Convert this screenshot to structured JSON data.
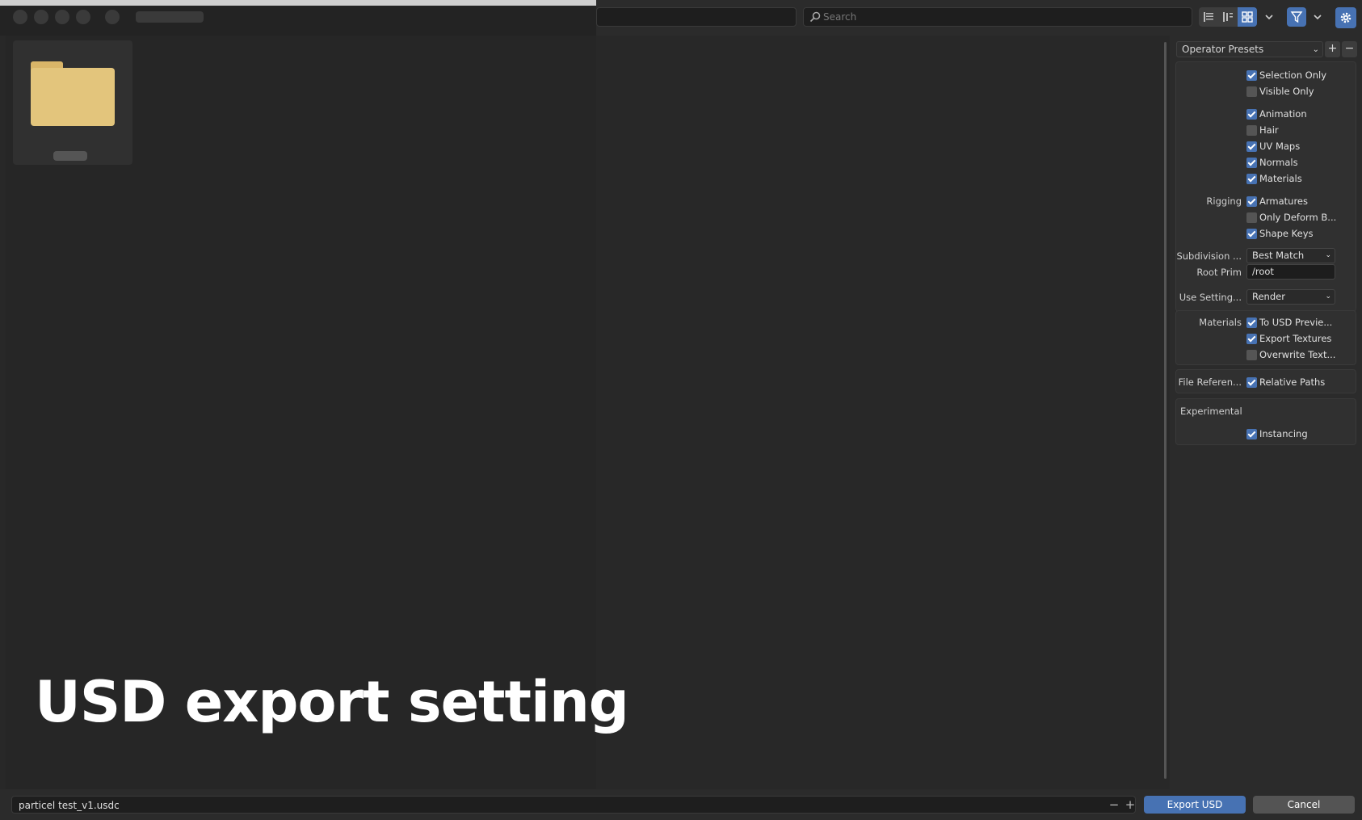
{
  "header": {
    "search_placeholder": "Search",
    "icons": [
      "list-vertical-icon",
      "list-horizontal-icon",
      "thumbnails-icon",
      "filter-icon",
      "gear-icon"
    ]
  },
  "overlay_title": "USD export setting",
  "sidebar": {
    "presets_label": "Operator Presets",
    "add_label": "+",
    "remove_label": "−",
    "general": {
      "selection_only": {
        "label": "Selection Only",
        "checked": true
      },
      "visible_only": {
        "label": "Visible Only",
        "checked": false
      },
      "animation": {
        "label": "Animation",
        "checked": true
      },
      "hair": {
        "label": "Hair",
        "checked": false
      },
      "uv_maps": {
        "label": "UV Maps",
        "checked": true
      },
      "normals": {
        "label": "Normals",
        "checked": true
      },
      "materials": {
        "label": "Materials",
        "checked": true
      },
      "rigging_label": "Rigging",
      "armatures": {
        "label": "Armatures",
        "checked": true
      },
      "only_deform": {
        "label": "Only Deform B...",
        "checked": false
      },
      "shape_keys": {
        "label": "Shape Keys",
        "checked": true
      },
      "subdivision_label": "Subdivision ...",
      "subdivision_value": "Best Match",
      "root_prim_label": "Root Prim",
      "root_prim_value": "/root",
      "use_settings_label": "Use Setting...",
      "use_settings_value": "Render"
    },
    "materials_panel": {
      "label": "Materials",
      "to_usd_preview": {
        "label": "To USD Previe...",
        "checked": true
      },
      "export_textures": {
        "label": "Export Textures",
        "checked": true
      },
      "overwrite_textures": {
        "label": "Overwrite Text...",
        "checked": false
      }
    },
    "file_refs": {
      "label": "File Referen...",
      "relative_paths": {
        "label": "Relative Paths",
        "checked": true
      }
    },
    "experimental": {
      "label": "Experimental",
      "instancing": {
        "label": "Instancing",
        "checked": true
      }
    }
  },
  "footer": {
    "filename": "particel test_v1.usdc",
    "minus_label": "−",
    "plus_label": "+",
    "export_label": "Export USD",
    "cancel_label": "Cancel"
  },
  "colors": {
    "accent": "#4772b3",
    "folder": "#e3c57c",
    "background": "#282828"
  }
}
